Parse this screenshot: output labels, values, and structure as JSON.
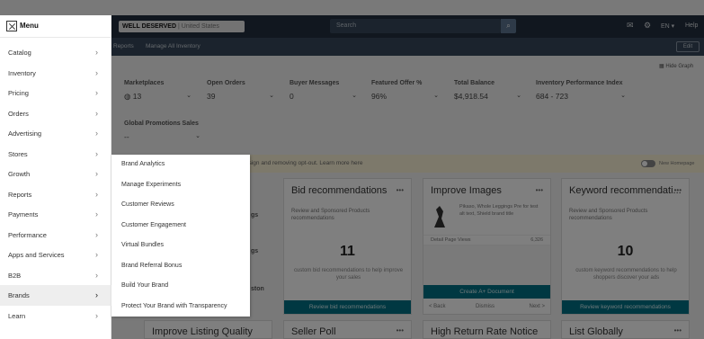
{
  "menu": {
    "title": "Menu",
    "items": [
      {
        "label": "Catalog"
      },
      {
        "label": "Inventory"
      },
      {
        "label": "Pricing"
      },
      {
        "label": "Orders"
      },
      {
        "label": "Advertising"
      },
      {
        "label": "Stores"
      },
      {
        "label": "Growth"
      },
      {
        "label": "Reports"
      },
      {
        "label": "Payments"
      },
      {
        "label": "Performance"
      },
      {
        "label": "Apps and Services"
      },
      {
        "label": "B2B"
      },
      {
        "label": "Brands"
      },
      {
        "label": "Learn"
      }
    ],
    "active_item": "Brands",
    "chevron": "›"
  },
  "flyout": {
    "items": [
      {
        "label": "Brand Analytics"
      },
      {
        "label": "Manage Experiments"
      },
      {
        "label": "Customer Reviews"
      },
      {
        "label": "Customer Engagement"
      },
      {
        "label": "Virtual Bundles"
      },
      {
        "label": "Brand Referral Bonus"
      },
      {
        "label": "Build Your Brand"
      },
      {
        "label": "Protect Your Brand with Transparency"
      }
    ]
  },
  "topbar": {
    "store_name": "WELL DESERVED",
    "store_region": "| United States",
    "search_placeholder": "Search",
    "language": "EN ▾",
    "help": "Help"
  },
  "subnav": {
    "items": [
      "Reports",
      "Manage All Inventory"
    ],
    "edit": "Edit"
  },
  "dashboard": {
    "hide_graph": "Hide Graph",
    "metrics": [
      {
        "label": "Marketplaces",
        "value": "13"
      },
      {
        "label": "Open Orders",
        "value": "39"
      },
      {
        "label": "Buyer Messages",
        "value": "0"
      },
      {
        "label": "Featured Offer %",
        "value": "96%"
      },
      {
        "label": "Total Balance",
        "value": "$4,918.54"
      },
      {
        "label": "Inventory Performance Index",
        "value": "684 - 723"
      },
      {
        "label": "Global Promotions Sales",
        "value": "--"
      }
    ],
    "banner_text": "esign and removing opt-out. Learn more here",
    "toggle_label": "New Homepage",
    "cards": [
      {
        "title": "Bid recommendations",
        "subtitle": "Review and Sponsored Products recommendations",
        "count": "11",
        "description": "custom bid recommendations to help improve your sales",
        "cta": "Review bid recommendations"
      },
      {
        "title": "Improve Images",
        "thumb_text": "Pikaso, Whole Leggings Pre for test alt text, Shield brand title",
        "dim_left": "Detail Page Views",
        "dim_right": "6,326",
        "cta": "Create A+ Document",
        "pager_prev": "< Back",
        "pager_mid": "Dismiss",
        "pager_next": "Next >"
      },
      {
        "title": "Keyword recommendati...",
        "subtitle": "Review and Sponsored Products recommendations",
        "count": "10",
        "description": "custom keyword recommendations to help shoppers discover your ads",
        "cta": "Review keyword recommendations"
      }
    ],
    "left_partial_labels": [
      "gs",
      "gs",
      "ston"
    ],
    "bottom_cards": [
      "Improve Listing Quality",
      "Seller Poll",
      "High Return Rate Notice",
      "List Globally"
    ]
  }
}
